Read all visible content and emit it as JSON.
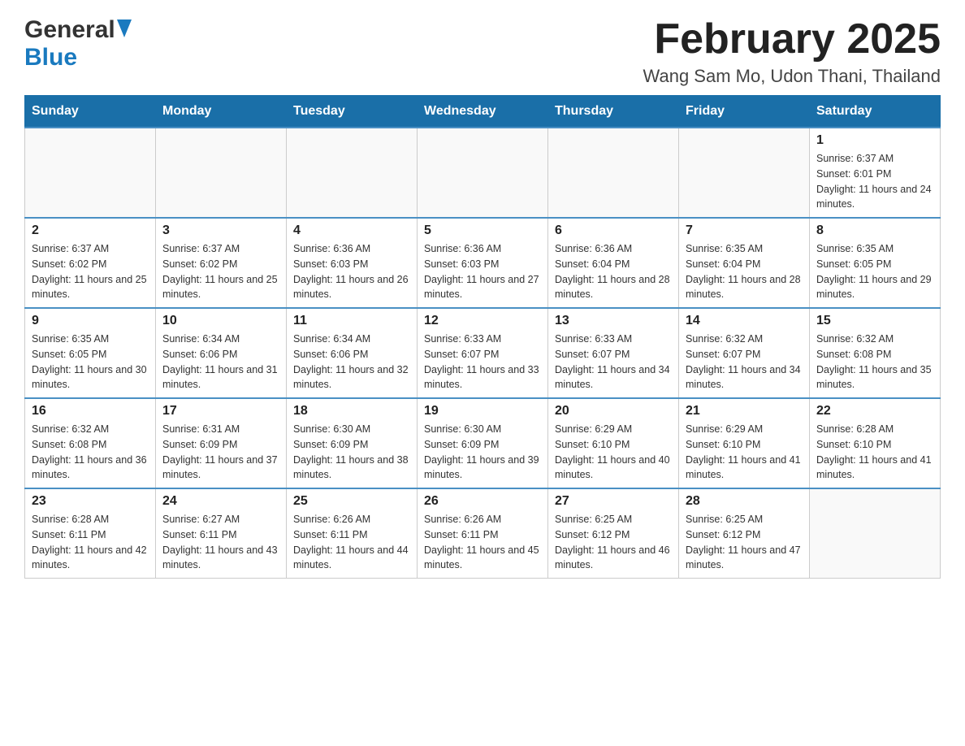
{
  "header": {
    "logo_general": "General",
    "logo_blue": "Blue",
    "month_title": "February 2025",
    "location": "Wang Sam Mo, Udon Thani, Thailand"
  },
  "days_of_week": [
    "Sunday",
    "Monday",
    "Tuesday",
    "Wednesday",
    "Thursday",
    "Friday",
    "Saturday"
  ],
  "weeks": [
    [
      {
        "day": "",
        "info": ""
      },
      {
        "day": "",
        "info": ""
      },
      {
        "day": "",
        "info": ""
      },
      {
        "day": "",
        "info": ""
      },
      {
        "day": "",
        "info": ""
      },
      {
        "day": "",
        "info": ""
      },
      {
        "day": "1",
        "info": "Sunrise: 6:37 AM\nSunset: 6:01 PM\nDaylight: 11 hours and 24 minutes."
      }
    ],
    [
      {
        "day": "2",
        "info": "Sunrise: 6:37 AM\nSunset: 6:02 PM\nDaylight: 11 hours and 25 minutes."
      },
      {
        "day": "3",
        "info": "Sunrise: 6:37 AM\nSunset: 6:02 PM\nDaylight: 11 hours and 25 minutes."
      },
      {
        "day": "4",
        "info": "Sunrise: 6:36 AM\nSunset: 6:03 PM\nDaylight: 11 hours and 26 minutes."
      },
      {
        "day": "5",
        "info": "Sunrise: 6:36 AM\nSunset: 6:03 PM\nDaylight: 11 hours and 27 minutes."
      },
      {
        "day": "6",
        "info": "Sunrise: 6:36 AM\nSunset: 6:04 PM\nDaylight: 11 hours and 28 minutes."
      },
      {
        "day": "7",
        "info": "Sunrise: 6:35 AM\nSunset: 6:04 PM\nDaylight: 11 hours and 28 minutes."
      },
      {
        "day": "8",
        "info": "Sunrise: 6:35 AM\nSunset: 6:05 PM\nDaylight: 11 hours and 29 minutes."
      }
    ],
    [
      {
        "day": "9",
        "info": "Sunrise: 6:35 AM\nSunset: 6:05 PM\nDaylight: 11 hours and 30 minutes."
      },
      {
        "day": "10",
        "info": "Sunrise: 6:34 AM\nSunset: 6:06 PM\nDaylight: 11 hours and 31 minutes."
      },
      {
        "day": "11",
        "info": "Sunrise: 6:34 AM\nSunset: 6:06 PM\nDaylight: 11 hours and 32 minutes."
      },
      {
        "day": "12",
        "info": "Sunrise: 6:33 AM\nSunset: 6:07 PM\nDaylight: 11 hours and 33 minutes."
      },
      {
        "day": "13",
        "info": "Sunrise: 6:33 AM\nSunset: 6:07 PM\nDaylight: 11 hours and 34 minutes."
      },
      {
        "day": "14",
        "info": "Sunrise: 6:32 AM\nSunset: 6:07 PM\nDaylight: 11 hours and 34 minutes."
      },
      {
        "day": "15",
        "info": "Sunrise: 6:32 AM\nSunset: 6:08 PM\nDaylight: 11 hours and 35 minutes."
      }
    ],
    [
      {
        "day": "16",
        "info": "Sunrise: 6:32 AM\nSunset: 6:08 PM\nDaylight: 11 hours and 36 minutes."
      },
      {
        "day": "17",
        "info": "Sunrise: 6:31 AM\nSunset: 6:09 PM\nDaylight: 11 hours and 37 minutes."
      },
      {
        "day": "18",
        "info": "Sunrise: 6:30 AM\nSunset: 6:09 PM\nDaylight: 11 hours and 38 minutes."
      },
      {
        "day": "19",
        "info": "Sunrise: 6:30 AM\nSunset: 6:09 PM\nDaylight: 11 hours and 39 minutes."
      },
      {
        "day": "20",
        "info": "Sunrise: 6:29 AM\nSunset: 6:10 PM\nDaylight: 11 hours and 40 minutes."
      },
      {
        "day": "21",
        "info": "Sunrise: 6:29 AM\nSunset: 6:10 PM\nDaylight: 11 hours and 41 minutes."
      },
      {
        "day": "22",
        "info": "Sunrise: 6:28 AM\nSunset: 6:10 PM\nDaylight: 11 hours and 41 minutes."
      }
    ],
    [
      {
        "day": "23",
        "info": "Sunrise: 6:28 AM\nSunset: 6:11 PM\nDaylight: 11 hours and 42 minutes."
      },
      {
        "day": "24",
        "info": "Sunrise: 6:27 AM\nSunset: 6:11 PM\nDaylight: 11 hours and 43 minutes."
      },
      {
        "day": "25",
        "info": "Sunrise: 6:26 AM\nSunset: 6:11 PM\nDaylight: 11 hours and 44 minutes."
      },
      {
        "day": "26",
        "info": "Sunrise: 6:26 AM\nSunset: 6:11 PM\nDaylight: 11 hours and 45 minutes."
      },
      {
        "day": "27",
        "info": "Sunrise: 6:25 AM\nSunset: 6:12 PM\nDaylight: 11 hours and 46 minutes."
      },
      {
        "day": "28",
        "info": "Sunrise: 6:25 AM\nSunset: 6:12 PM\nDaylight: 11 hours and 47 minutes."
      },
      {
        "day": "",
        "info": ""
      }
    ]
  ]
}
